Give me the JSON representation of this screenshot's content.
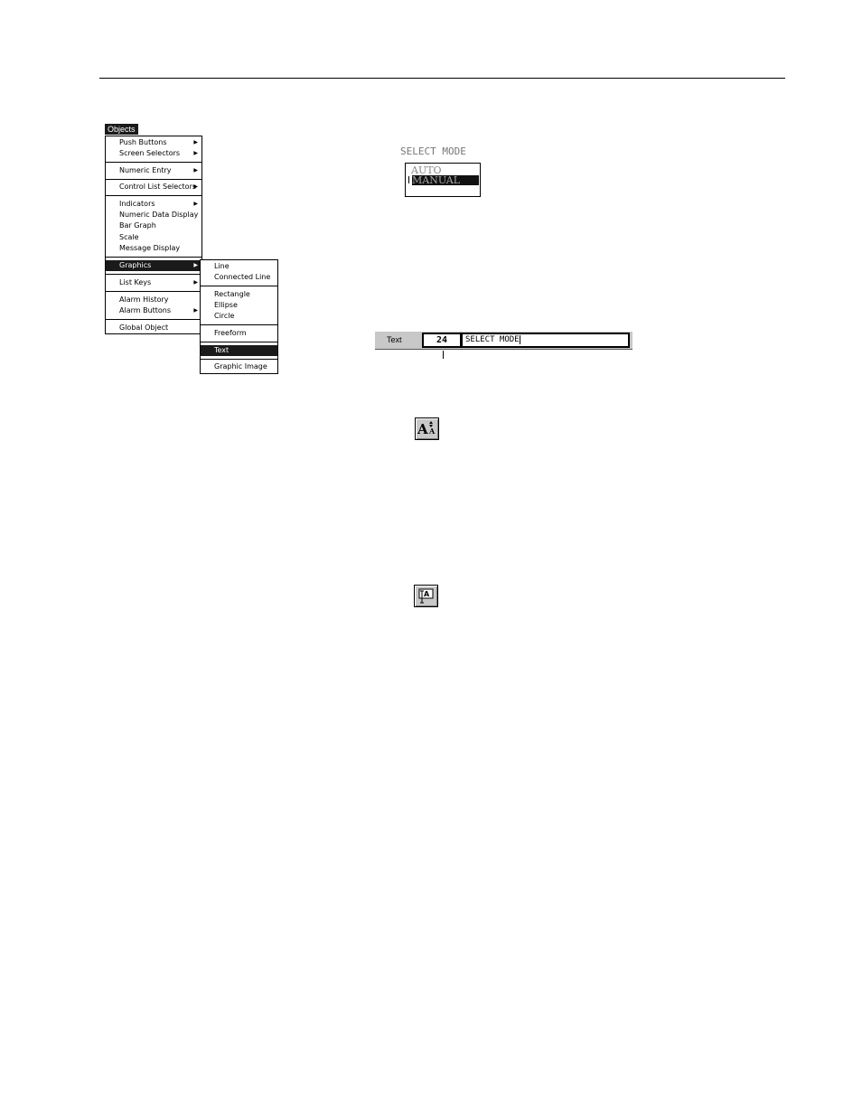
{
  "objects_menu": {
    "title": "Objects",
    "items": [
      {
        "label": "Push Buttons",
        "submenu": true
      },
      {
        "label": "Screen Selectors",
        "submenu": true
      },
      {
        "label": "Numeric Entry",
        "submenu": true
      },
      {
        "label": "Control List Selectors",
        "submenu": true
      },
      {
        "label": "Indicators",
        "submenu": true
      },
      {
        "label": "Numeric Data Display",
        "submenu": false
      },
      {
        "label": "Bar Graph",
        "submenu": false
      },
      {
        "label": "Scale",
        "submenu": false
      },
      {
        "label": "Message Display",
        "submenu": false
      },
      {
        "label": "Graphics",
        "submenu": true,
        "selected": true
      },
      {
        "label": "List Keys",
        "submenu": true
      },
      {
        "label": "Alarm History",
        "submenu": false
      },
      {
        "label": "Alarm Buttons",
        "submenu": true
      },
      {
        "label": "Global Object",
        "submenu": false
      }
    ],
    "arrow_glyph": "▶"
  },
  "graphics_menu": {
    "items": [
      "Line",
      "Connected Line",
      "Rectangle",
      "Ellipse",
      "Circle",
      "Freeform",
      "Text",
      "Graphic Image"
    ],
    "selected": "Text"
  },
  "select_mode": {
    "title": "SELECT MODE",
    "options": [
      "AUTO",
      "MANUAL"
    ],
    "highlighted": "MANUAL"
  },
  "text_toolbar": {
    "label": "Text",
    "size_value": "24",
    "text_value": "SELECT MODE"
  },
  "icons": {
    "text_size_icon": "text-size-icon",
    "text_tool_icon": "text-tool-icon"
  }
}
